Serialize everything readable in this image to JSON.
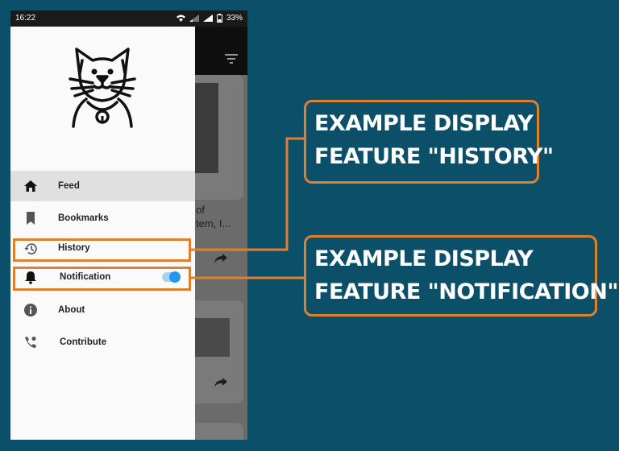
{
  "status": {
    "time": "16:22",
    "battery": "33%"
  },
  "background_card": {
    "line1": "of",
    "line2": "tem, I..."
  },
  "menu": [
    {
      "label": "Feed",
      "icon": "home-icon"
    },
    {
      "label": "Bookmarks",
      "icon": "bookmark-icon"
    },
    {
      "label": "History",
      "icon": "history-icon"
    },
    {
      "label": "Notification",
      "icon": "bell-icon"
    },
    {
      "label": "About",
      "icon": "info-icon"
    },
    {
      "label": "Contribute",
      "icon": "contact-phone-icon"
    }
  ],
  "notification_toggle_on": true,
  "callouts": {
    "history": {
      "line1": "EXAMPLE DISPLAY",
      "line2": "FEATURE \"HISTORY\""
    },
    "notification": {
      "line1": "EXAMPLE DISPLAY",
      "line2": "FEATURE \"NOTIFICATION\""
    }
  },
  "colors": {
    "background": "#0b5068",
    "accent": "#e07f2e",
    "toggle": "#2196f3"
  }
}
